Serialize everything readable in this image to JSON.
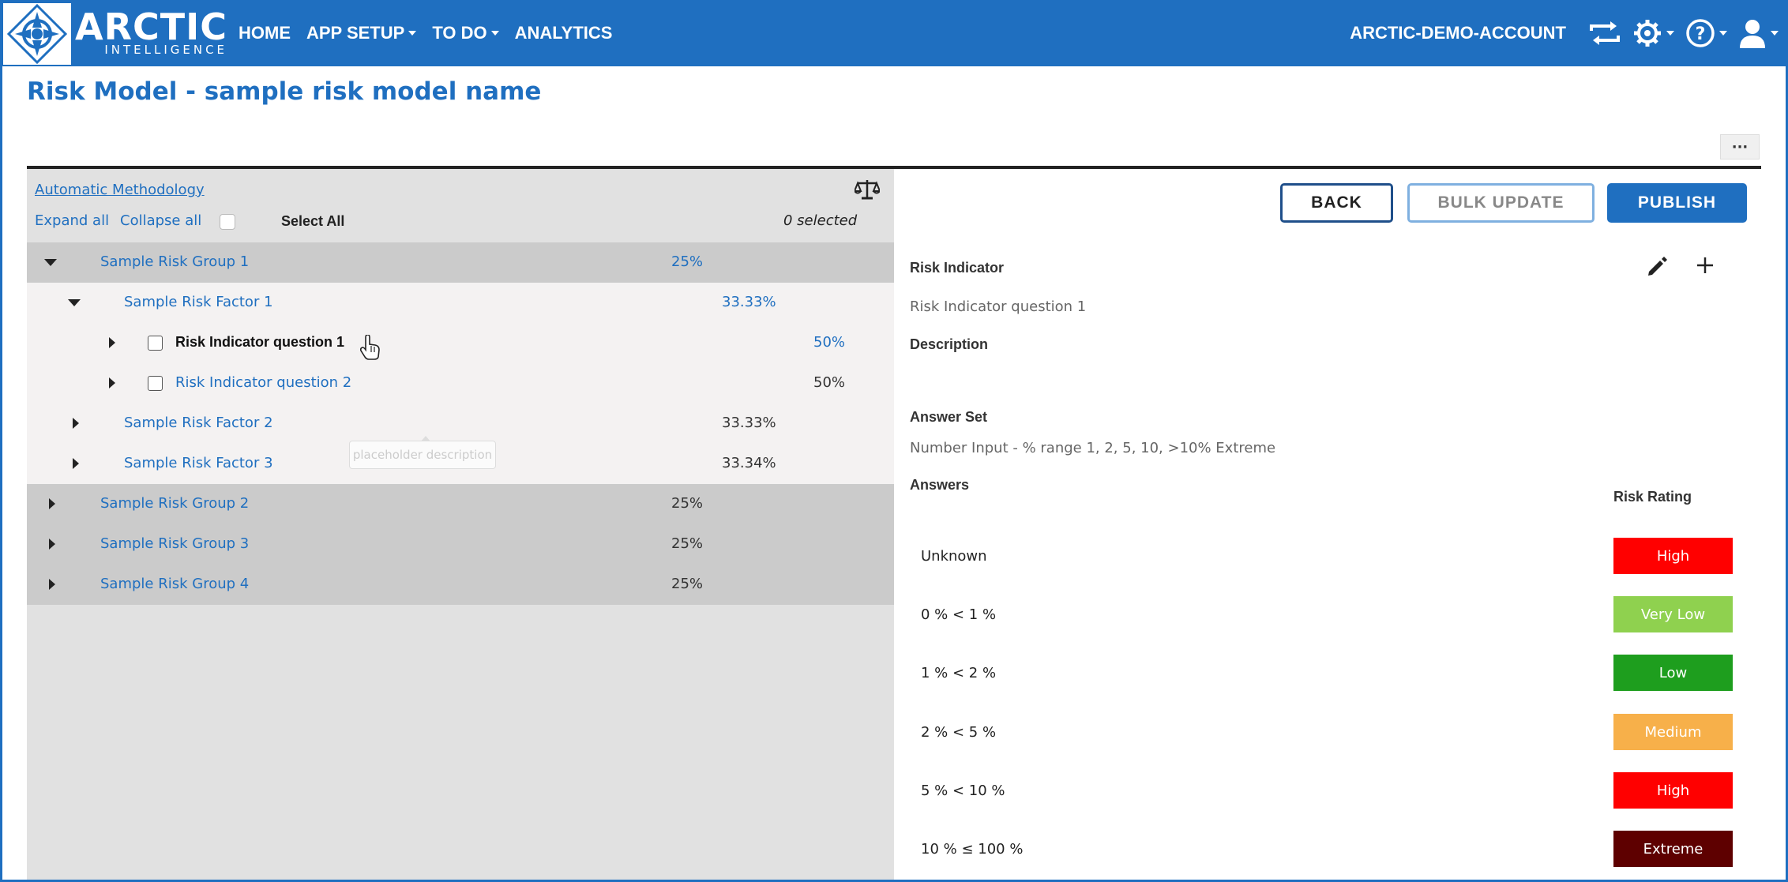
{
  "navbar": {
    "logo": {
      "big": "ARCTIC",
      "small": "INTELLIGENCE"
    },
    "items": [
      {
        "label": "HOME",
        "dropdown": false
      },
      {
        "label": "APP SETUP",
        "dropdown": true
      },
      {
        "label": "TO DO",
        "dropdown": true
      },
      {
        "label": "ANALYTICS",
        "dropdown": false
      }
    ],
    "account": "ARCTIC-DEMO-ACCOUNT",
    "icons": [
      "switch-account-icon",
      "gear-icon",
      "help-icon",
      "user-icon"
    ]
  },
  "page": {
    "title": "Risk Model - sample risk model name",
    "more_label": "···"
  },
  "left": {
    "methodology_link": "Automatic Methodology",
    "expand_all": "Expand all",
    "collapse_all": "Collapse all",
    "select_all": "Select All",
    "selected_count": "0 selected",
    "tree": [
      {
        "label": "Sample Risk Group 1",
        "pct": "25%",
        "level": "group",
        "expanded": true
      },
      {
        "label": "Sample Risk Factor 1",
        "pct": "33.33%",
        "level": "factor",
        "expanded": true
      },
      {
        "label": "Risk Indicator question 1",
        "pct": "50%",
        "level": "indicator",
        "selected_row": true
      },
      {
        "label": "Risk Indicator question 2",
        "pct": "50%",
        "level": "indicator"
      },
      {
        "label": "Sample Risk Factor 2",
        "pct": "33.33%",
        "level": "factor"
      },
      {
        "label": "Sample Risk Factor 3",
        "pct": "33.34%",
        "level": "factor"
      },
      {
        "label": "Sample Risk Group 2",
        "pct": "25%",
        "level": "group"
      },
      {
        "label": "Sample Risk Group 3",
        "pct": "25%",
        "level": "group"
      },
      {
        "label": "Sample Risk Group 4",
        "pct": "25%",
        "level": "group"
      }
    ],
    "tooltip": "placeholder description"
  },
  "actions": {
    "back": "BACK",
    "bulk_update": "BULK UPDATE",
    "publish": "PUBLISH"
  },
  "detail": {
    "risk_indicator_label": "Risk Indicator",
    "risk_indicator_value": "Risk Indicator question 1",
    "description_label": "Description",
    "answer_set_label": "Answer Set",
    "answer_set_value": "Number Input - % range 1, 2, 5, 10, >10% Extreme",
    "answers_label": "Answers",
    "risk_rating_label": "Risk Rating",
    "answers": [
      {
        "answer": "Unknown",
        "rating": "High",
        "color": "#ff0000"
      },
      {
        "answer": "0 % < 1 %",
        "rating": "Very Low",
        "color": "#8fd14f"
      },
      {
        "answer": "1 % < 2 %",
        "rating": "Low",
        "color": "#1e9e1e"
      },
      {
        "answer": "2 % < 5 %",
        "rating": "Medium",
        "color": "#f7b04a"
      },
      {
        "answer": "5 % < 10 %",
        "rating": "High",
        "color": "#ff0000"
      },
      {
        "answer": "10 % ≤ 100 %",
        "rating": "Extreme",
        "color": "#5e0000"
      }
    ]
  },
  "colors": {
    "brand": "#1f6fc0",
    "panel_bg": "#e1e1e1",
    "group_row_bg": "#cbcbcb",
    "light_row_bg": "#f4f2f2"
  }
}
